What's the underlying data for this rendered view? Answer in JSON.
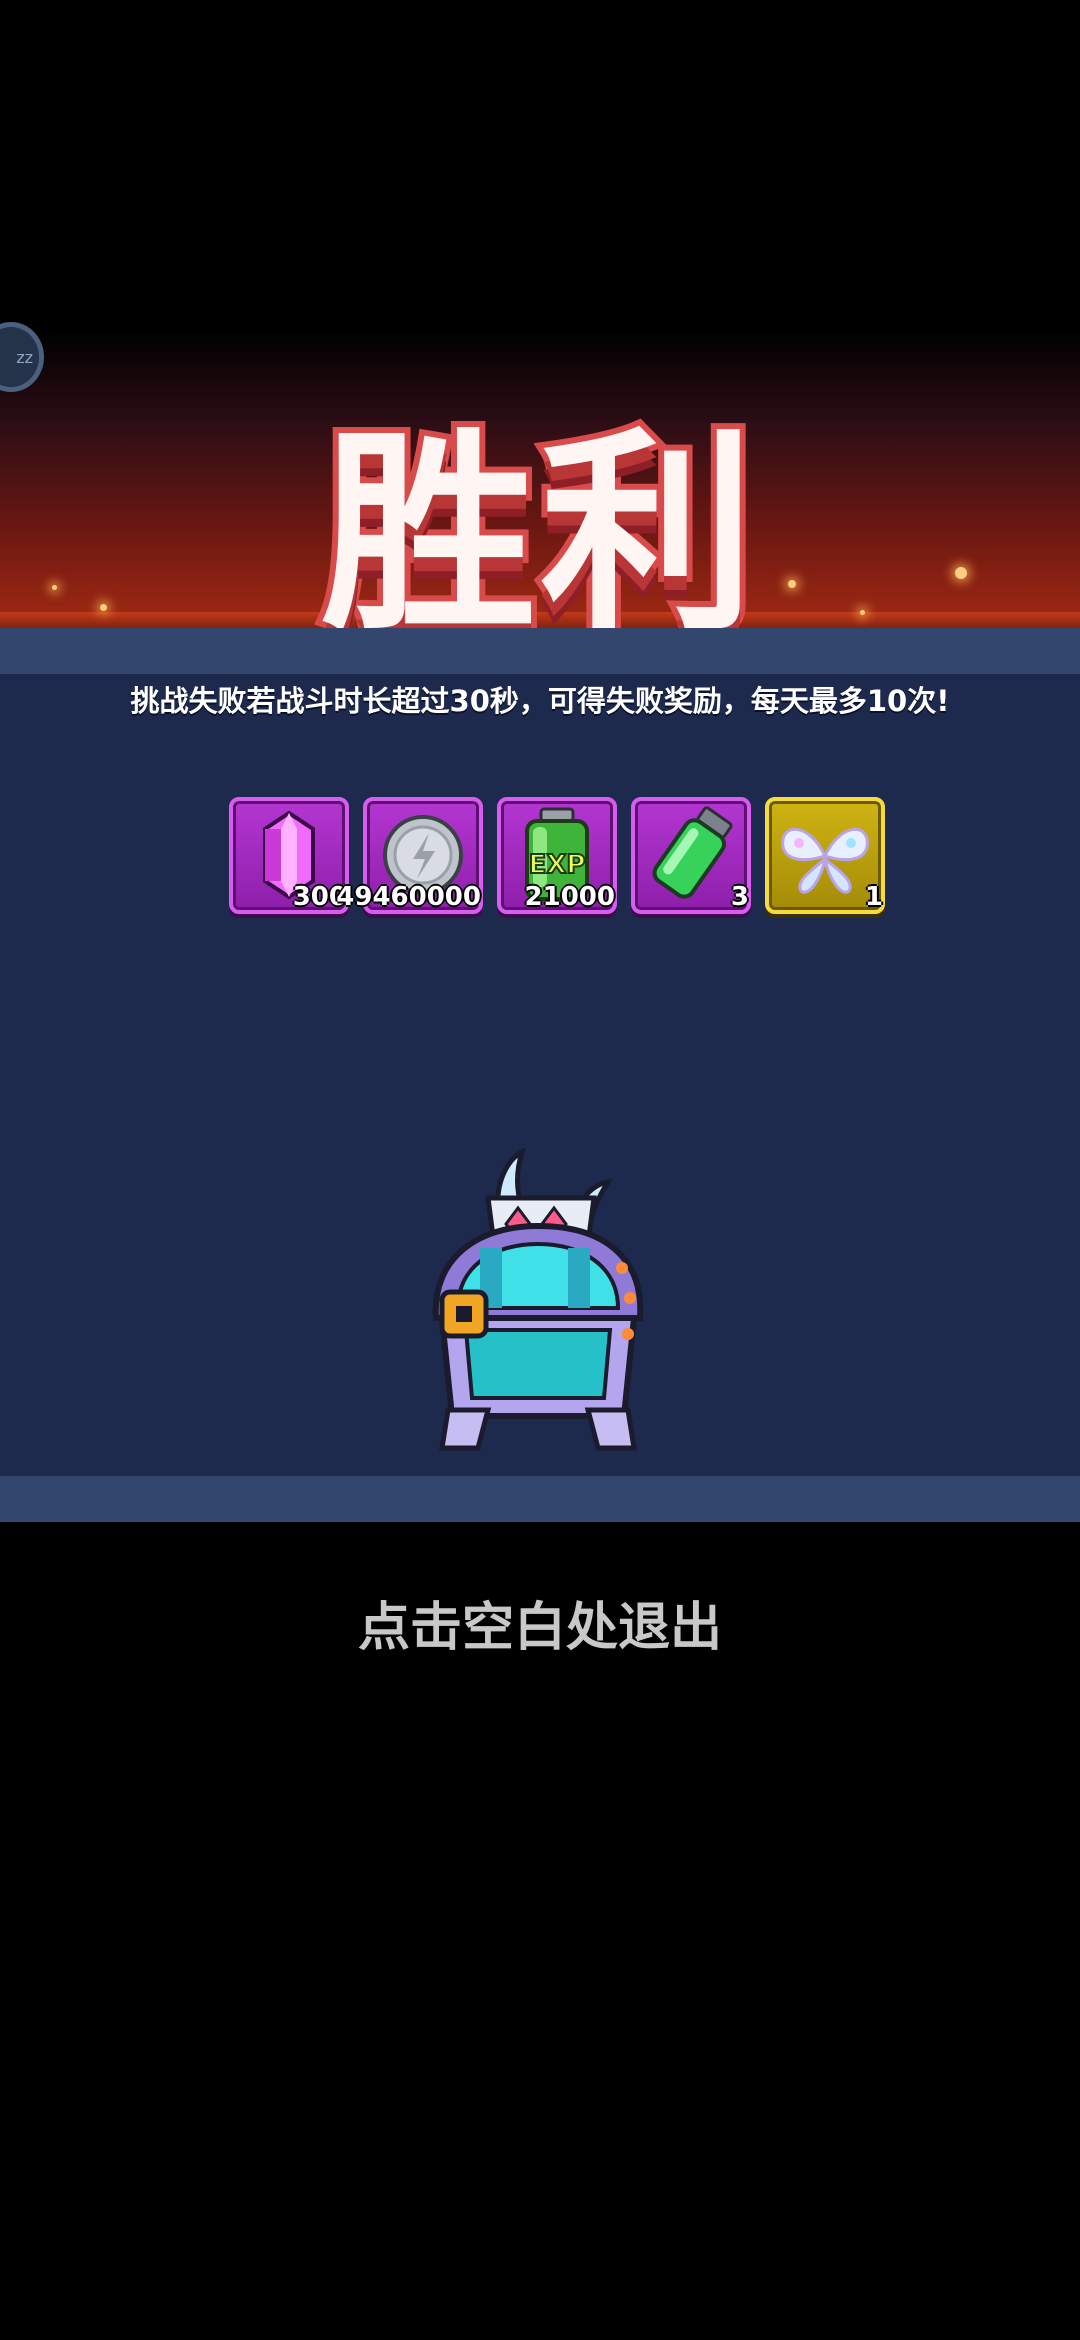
{
  "result": {
    "title": "胜利"
  },
  "avatar_badge": {
    "text": "zz"
  },
  "notice": "挑战失败若战斗时长超过30秒，可得失败奖励，每天最多10次!",
  "rewards": [
    {
      "icon": "gem-icon",
      "quantity": "300",
      "frame": "purple"
    },
    {
      "icon": "silver-coin-icon",
      "quantity": "49460000",
      "frame": "purple"
    },
    {
      "icon": "exp-potion-icon",
      "quantity": "21000",
      "frame": "purple"
    },
    {
      "icon": "green-vial-icon",
      "quantity": "3",
      "frame": "purple"
    },
    {
      "icon": "butterfly-wings-icon",
      "quantity": "1",
      "frame": "gold"
    }
  ],
  "chest": {
    "icon": "treasure-chest-icon"
  },
  "exit_hint": "点击空白处退出",
  "colors": {
    "panel": "#1d2a4d",
    "title_stroke": "#d94a4a",
    "item_frame_purple": "#b436d2",
    "item_frame_gold": "#cfb414"
  }
}
